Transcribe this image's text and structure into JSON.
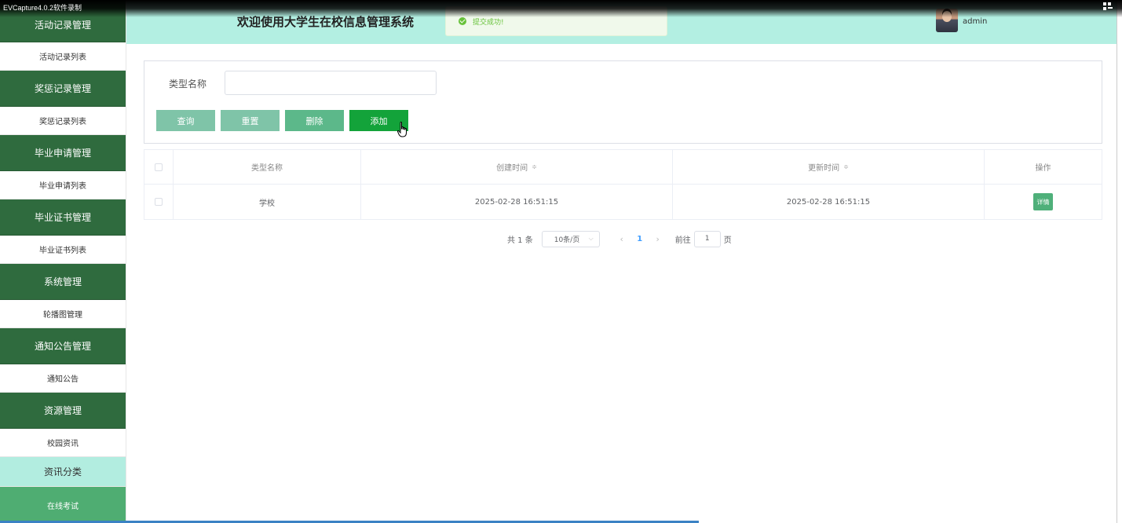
{
  "recorder": {
    "label": "EVCapture4.0.2软件录制"
  },
  "sidebar": {
    "items": [
      {
        "type": "group",
        "label": "活动记录管理"
      },
      {
        "type": "item",
        "label": "活动记录列表"
      },
      {
        "type": "group",
        "label": "奖惩记录管理"
      },
      {
        "type": "item",
        "label": "奖惩记录列表"
      },
      {
        "type": "group",
        "label": "毕业申请管理"
      },
      {
        "type": "item",
        "label": "毕业申请列表"
      },
      {
        "type": "group",
        "label": "毕业证书管理"
      },
      {
        "type": "item",
        "label": "毕业证书列表"
      },
      {
        "type": "group",
        "label": "系统管理"
      },
      {
        "type": "item",
        "label": "轮播图管理"
      },
      {
        "type": "group",
        "label": "通知公告管理"
      },
      {
        "type": "item",
        "label": "通知公告"
      },
      {
        "type": "group",
        "label": "资源管理"
      },
      {
        "type": "item",
        "label": "校园资讯"
      },
      {
        "type": "active",
        "label": "资讯分类"
      },
      {
        "type": "group",
        "label": "在线考试"
      }
    ]
  },
  "header": {
    "title": "欢迎使用大学生在校信息管理系统",
    "toast": "提交成功!",
    "username": "admin"
  },
  "search": {
    "label": "类型名称",
    "input_value": "",
    "buttons": {
      "query": "查询",
      "reset": "重置",
      "delete": "删除",
      "add": "添加"
    }
  },
  "table": {
    "headers": [
      "类型名称",
      "创建时间",
      "更新时间",
      "操作"
    ],
    "sort_glyph": "≑",
    "rows": [
      {
        "name": "学校",
        "created": "2025-02-28 16:51:15",
        "updated": "2025-02-28 16:51:15",
        "action": "详情"
      }
    ]
  },
  "pagination": {
    "total": "共 1 条",
    "page_size": "10条/页",
    "prev": "‹",
    "current": "1",
    "next": "›",
    "goto_label": "前往",
    "goto_value": "1",
    "page_suffix": "页"
  },
  "colors": {
    "sidebar_group": "#2f6b3e",
    "header_bg": "#b3efe2",
    "add_button": "#13a33a",
    "detail_button": "#4fb07a",
    "success": "#67c23a"
  }
}
